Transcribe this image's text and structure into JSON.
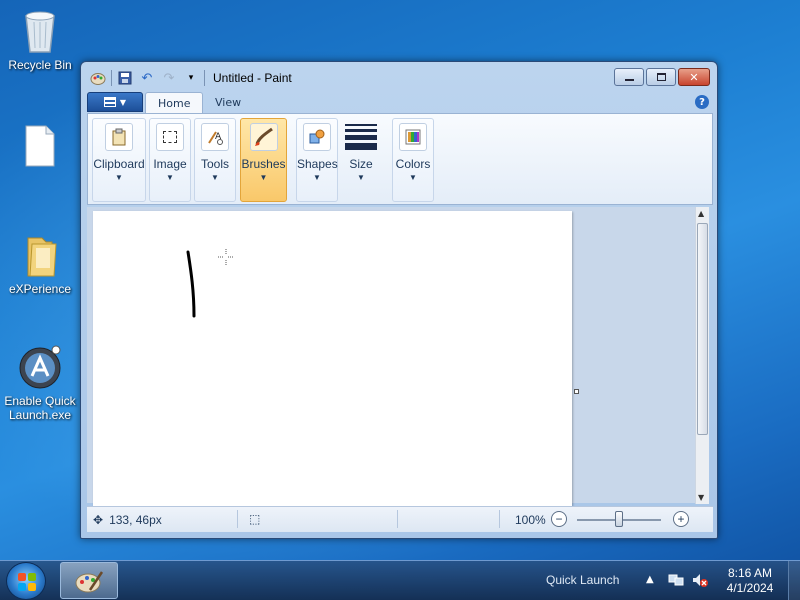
{
  "desktop": {
    "icons": [
      {
        "label": "Recycle Bin",
        "icon": "recycle-bin-icon"
      },
      {
        "label": "",
        "icon": "document-icon"
      },
      {
        "label": "eXPerience",
        "icon": "folder-icon"
      },
      {
        "label": "Enable Quick Launch.exe",
        "label_lines": [
          "Enable Quick",
          "Launch.exe"
        ],
        "icon": "quick-launch-app-icon"
      }
    ]
  },
  "window": {
    "title": "Untitled - Paint",
    "tabs": [
      {
        "label": "Home",
        "active": true
      },
      {
        "label": "View",
        "active": false
      }
    ],
    "ribbon_groups": [
      {
        "label": "Clipboard",
        "icon": "clipboard-icon",
        "selected": false
      },
      {
        "label": "Image",
        "icon": "select-icon",
        "selected": false
      },
      {
        "label": "Tools",
        "icon": "tools-icon",
        "selected": false
      },
      {
        "label": "Brushes",
        "icon": "brush-icon",
        "selected": true
      },
      {
        "label": "Shapes",
        "icon": "shapes-icon",
        "selected": false
      },
      {
        "label": "Size",
        "icon": "line-size-icon",
        "selected": false
      },
      {
        "label": "Colors",
        "icon": "colors-icon",
        "selected": false
      }
    ],
    "status": {
      "coordinates": "133, 46px",
      "zoom": "100%",
      "zoom_level": 1.0
    }
  },
  "taskbar": {
    "quick_launch_label": "Quick Launch",
    "time": "8:16 AM",
    "date": "4/1/2024"
  },
  "colors": {
    "accent": "#1d7fd2",
    "brush_selected": "#f9c86a",
    "close_button": "#c8442e"
  }
}
